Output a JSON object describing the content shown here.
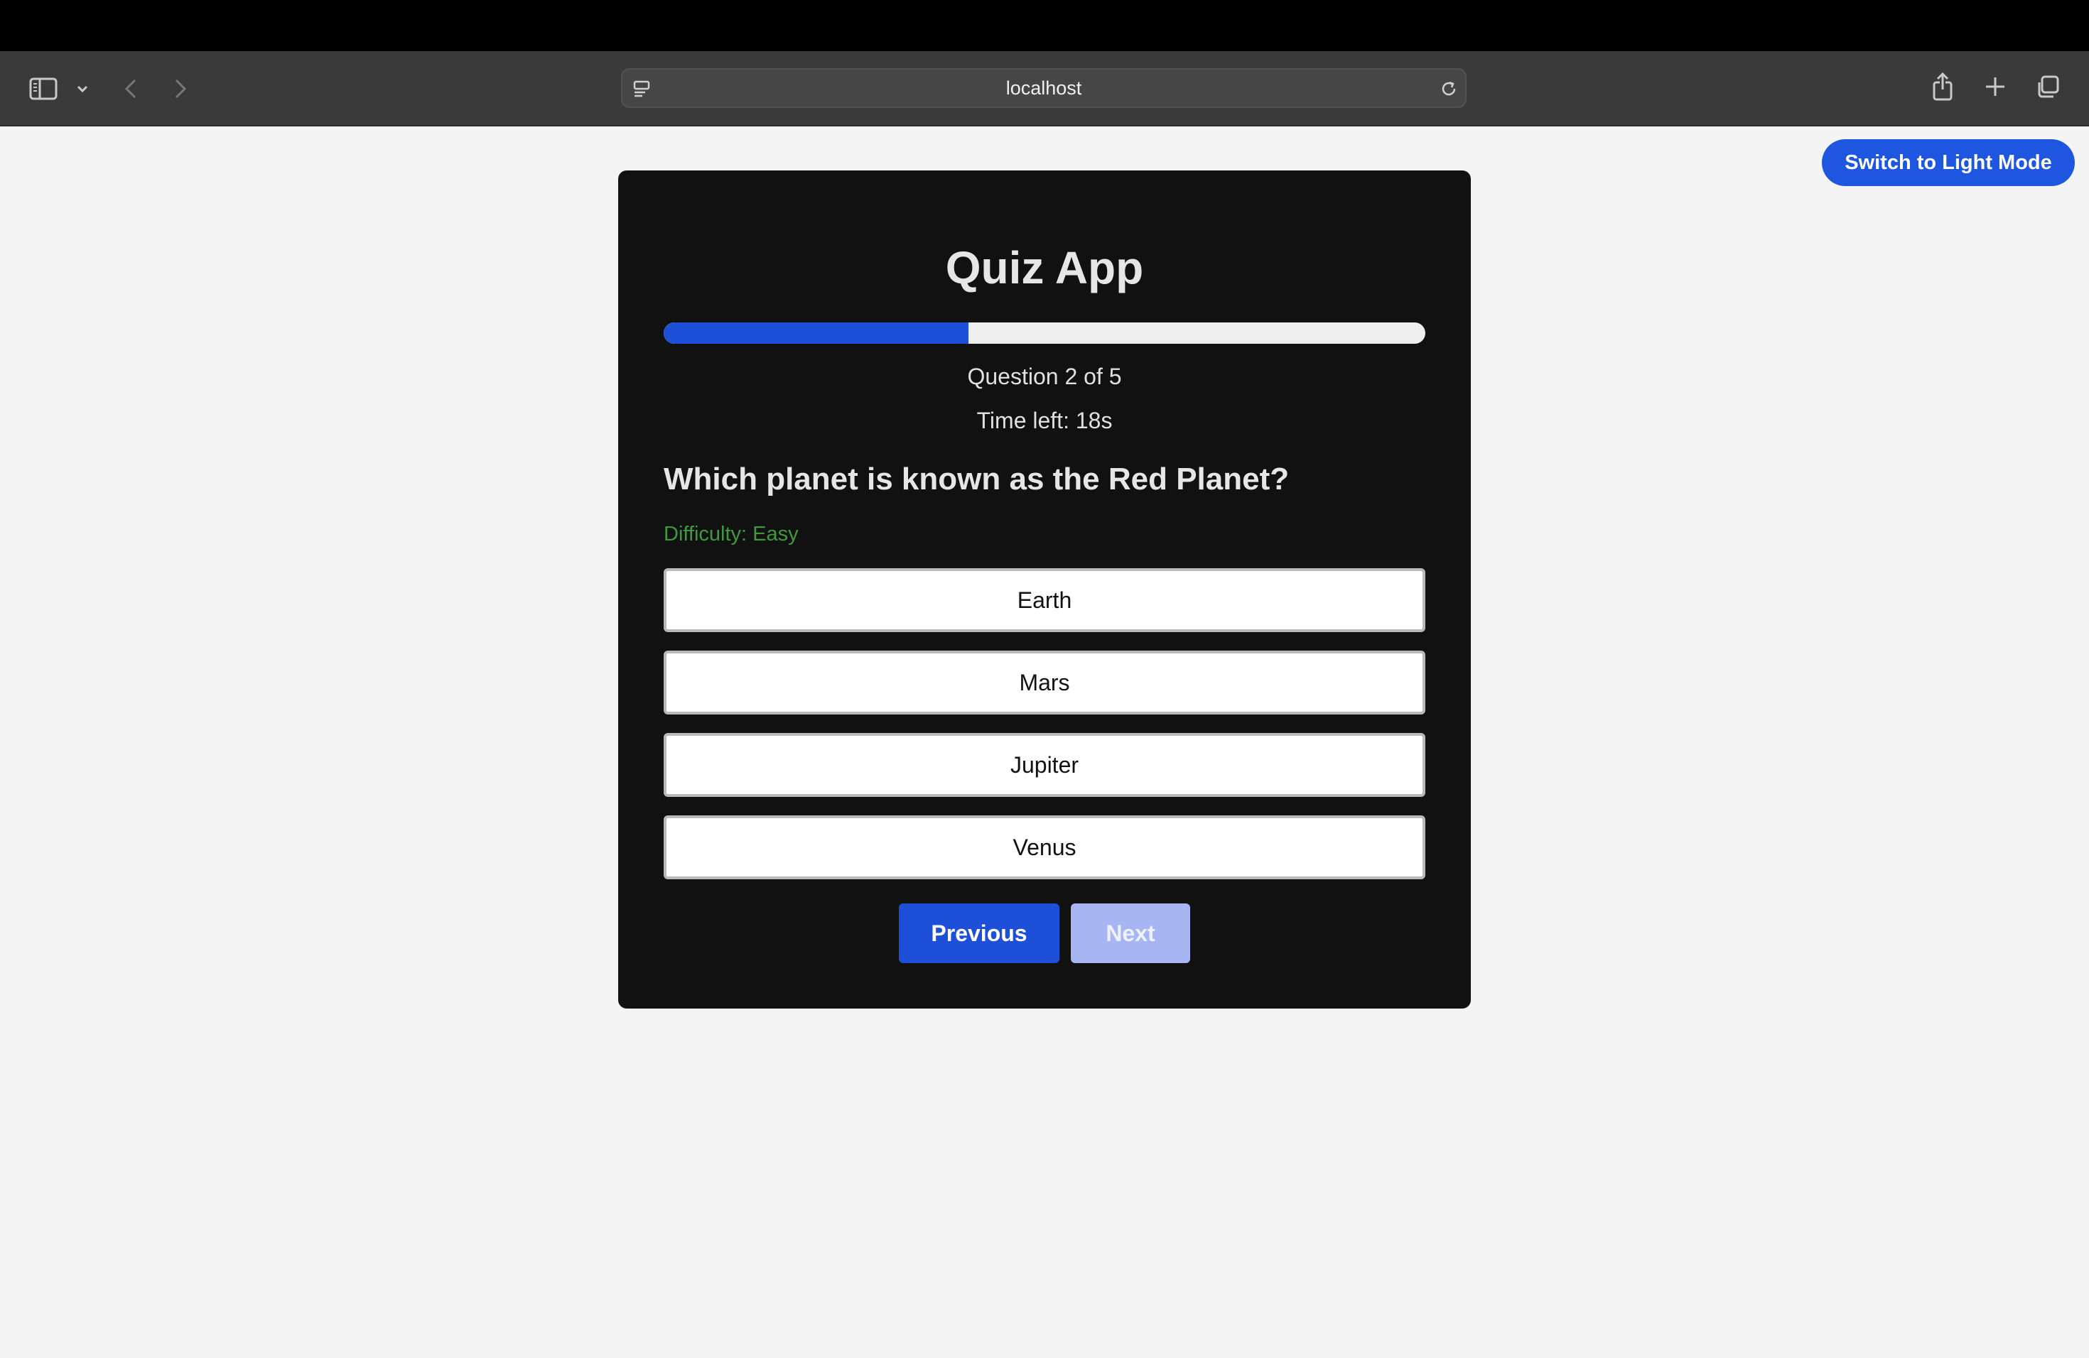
{
  "browser": {
    "url": "localhost"
  },
  "theme_toggle": {
    "label": "Switch to Light Mode"
  },
  "quiz": {
    "title": "Quiz App",
    "progress_percent": 40,
    "question_counter": "Question 2 of 5",
    "timer": "Time left: 18s",
    "question": "Which planet is known as the Red Planet?",
    "difficulty": "Difficulty: Easy",
    "options": [
      "Earth",
      "Mars",
      "Jupiter",
      "Venus"
    ],
    "previous_label": "Previous",
    "next_label": "Next"
  },
  "colors": {
    "accent": "#1e4fd8",
    "next_disabled": "#a7b6f2",
    "difficulty_easy": "#3f9a3f",
    "card_bg": "#111111"
  }
}
